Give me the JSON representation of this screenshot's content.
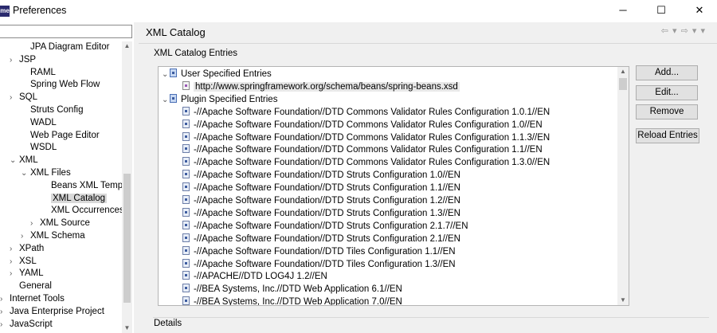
{
  "window": {
    "app_icon": "me",
    "title": "Preferences",
    "minimize_icon": "minimize-icon",
    "maximize_icon": "maximize-icon",
    "close_icon": "close-icon"
  },
  "sidebar": {
    "filter_value": "",
    "items": [
      {
        "label": "JPA Diagram Editor",
        "twisty": ""
      },
      {
        "label": "JSP",
        "twisty": "›"
      },
      {
        "label": "RAML",
        "twisty": ""
      },
      {
        "label": "Spring Web Flow",
        "twisty": ""
      },
      {
        "label": "SQL",
        "twisty": "›"
      },
      {
        "label": "Struts Config",
        "twisty": ""
      },
      {
        "label": "WADL",
        "twisty": ""
      },
      {
        "label": "Web Page Editor",
        "twisty": ""
      },
      {
        "label": "WSDL",
        "twisty": ""
      },
      {
        "label": "XML",
        "twisty": "⌄"
      },
      {
        "label": "XML Files",
        "twisty": "⌄"
      },
      {
        "label": "Beans XML Temp",
        "twisty": ""
      },
      {
        "label": "XML Catalog",
        "twisty": ""
      },
      {
        "label": "XML Occurrences",
        "twisty": ""
      },
      {
        "label": "XML Source",
        "twisty": "›"
      },
      {
        "label": "XML Schema",
        "twisty": "›"
      },
      {
        "label": "XPath",
        "twisty": "›"
      },
      {
        "label": "XSL",
        "twisty": "›"
      },
      {
        "label": "YAML",
        "twisty": "›"
      },
      {
        "label": "General",
        "twisty": ""
      },
      {
        "label": "Internet Tools",
        "twisty": "›"
      },
      {
        "label": "Java Enterprise Project",
        "twisty": "›"
      },
      {
        "label": "JavaScript",
        "twisty": "›"
      }
    ]
  },
  "main": {
    "page_title": "XML Catalog",
    "nav_arrows": "⇦ ▾ ⇨ ▾ ▾",
    "group_label": "XML Catalog Entries",
    "user_entries_label": "User Specified Entries",
    "user_entries": [
      "http://www.springframework.org/schema/beans/spring-beans.xsd"
    ],
    "plugin_entries_label": "Plugin Specified Entries",
    "plugin_entries": [
      "-//Apache Software Foundation//DTD Commons Validator Rules Configuration 1.0.1//EN",
      "-//Apache Software Foundation//DTD Commons Validator Rules Configuration 1.0//EN",
      "-//Apache Software Foundation//DTD Commons Validator Rules Configuration 1.1.3//EN",
      "-//Apache Software Foundation//DTD Commons Validator Rules Configuration 1.1//EN",
      "-//Apache Software Foundation//DTD Commons Validator Rules Configuration 1.3.0//EN",
      "-//Apache Software Foundation//DTD Struts Configuration 1.0//EN",
      "-//Apache Software Foundation//DTD Struts Configuration 1.1//EN",
      "-//Apache Software Foundation//DTD Struts Configuration 1.2//EN",
      "-//Apache Software Foundation//DTD Struts Configuration 1.3//EN",
      "-//Apache Software Foundation//DTD Struts Configuration 2.1.7//EN",
      "-//Apache Software Foundation//DTD Struts Configuration 2.1//EN",
      "-//Apache Software Foundation//DTD Tiles Configuration 1.1//EN",
      "-//Apache Software Foundation//DTD Tiles Configuration 1.3//EN",
      "-//APACHE//DTD LOG4J 1.2//EN",
      "-//BEA Systems, Inc.//DTD Web Application 6.1//EN",
      "-//BEA Systems, Inc.//DTD Web Application 7.0//EN"
    ],
    "buttons": {
      "add": "Add...",
      "edit": "Edit...",
      "remove": "Remove",
      "reload": "Reload Entries"
    },
    "details_label": "Details"
  }
}
